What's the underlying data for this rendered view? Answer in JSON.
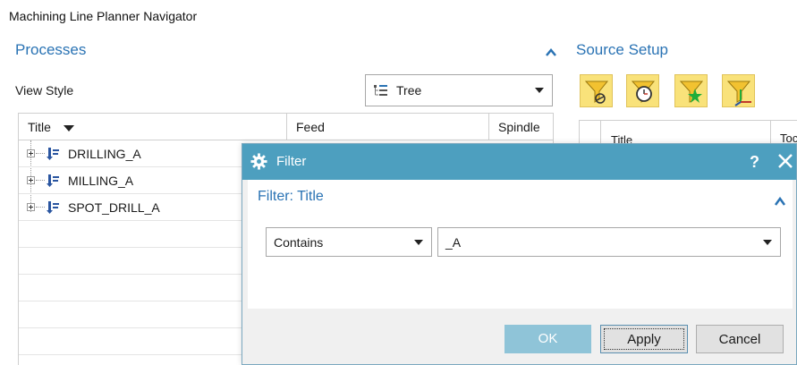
{
  "app": {
    "title": "Machining Line Planner Navigator"
  },
  "processes": {
    "title": "Processes",
    "view_style_label": "View Style",
    "view_style_value": "Tree",
    "columns": [
      "Title",
      "Feed",
      "Spindle"
    ],
    "rows": [
      {
        "label": "DRILLING_A"
      },
      {
        "label": "MILLING_A"
      },
      {
        "label": "SPOT_DRILL_A"
      }
    ]
  },
  "source_setup": {
    "title": "Source Setup",
    "tools": [
      "filter-tool-icon",
      "filter-time-icon",
      "filter-star-icon",
      "filter-axis-icon"
    ],
    "columns": [
      "Title",
      "Toc"
    ]
  },
  "dialog": {
    "title": "Filter",
    "help": "?",
    "section_title": "Filter: Title",
    "condition_value": "Contains",
    "filter_value": "_A",
    "ok_label": "OK",
    "apply_label": "Apply",
    "cancel_label": "Cancel"
  },
  "colors": {
    "accent_blue": "#2a73b4",
    "titlebar": "#4d9fbf",
    "toolbar_yellow": "#f9e27a",
    "ok_disabled": "#8fc4d8"
  }
}
